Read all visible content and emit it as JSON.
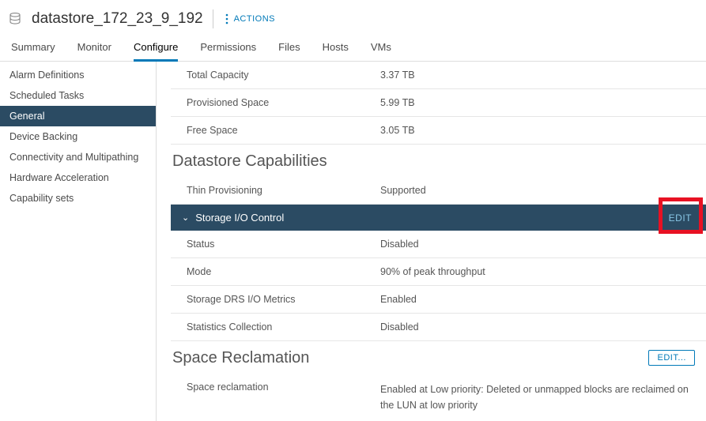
{
  "header": {
    "title": "datastore_172_23_9_192",
    "actions_label": "ACTIONS"
  },
  "tabs": [
    "Summary",
    "Monitor",
    "Configure",
    "Permissions",
    "Files",
    "Hosts",
    "VMs"
  ],
  "active_tab_index": 2,
  "sidebar": {
    "items": [
      "Alarm Definitions",
      "Scheduled Tasks",
      "General",
      "Device Backing",
      "Connectivity and Multipathing",
      "Hardware Acceleration",
      "Capability sets"
    ],
    "active_index": 2
  },
  "summary_rows": [
    {
      "label": "Total Capacity",
      "value": "3.37 TB"
    },
    {
      "label": "Provisioned Space",
      "value": "5.99 TB"
    },
    {
      "label": "Free Space",
      "value": "3.05 TB"
    }
  ],
  "sections": {
    "capabilities": {
      "title": "Datastore Capabilities",
      "thin_row": {
        "label": "Thin Provisioning",
        "value": "Supported"
      },
      "sioc": {
        "header": "Storage I/O Control",
        "edit_label": "EDIT",
        "rows": [
          {
            "label": "Status",
            "value": "Disabled"
          },
          {
            "label": "Mode",
            "value": "90% of peak throughput"
          },
          {
            "label": "Storage DRS I/O Metrics",
            "value": "Enabled"
          },
          {
            "label": "Statistics Collection",
            "value": "Disabled"
          }
        ]
      }
    },
    "reclamation": {
      "title": "Space Reclamation",
      "edit_label": "EDIT...",
      "row": {
        "label": "Space reclamation",
        "value": "Enabled at Low priority: Deleted or unmapped blocks are reclaimed on the LUN at low priority"
      }
    }
  }
}
